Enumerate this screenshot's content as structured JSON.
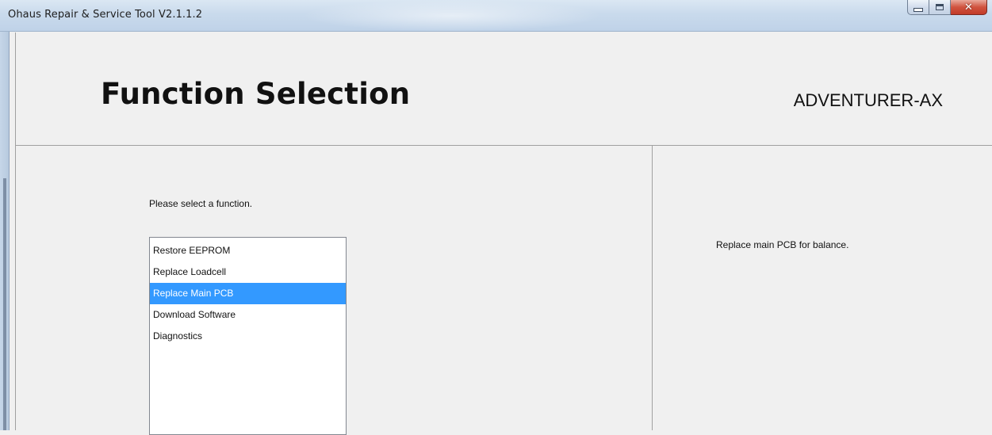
{
  "window": {
    "title": "Ohaus Repair & Service Tool  V2.1.1.2",
    "controls": {
      "minimize_icon": "minimize-icon",
      "maximize_icon": "maximize-icon",
      "close_icon": "close-icon",
      "close_glyph": "✕"
    }
  },
  "header": {
    "title": "Function Selection",
    "model": "ADVENTURER-AX"
  },
  "functions": {
    "prompt": "Please select a function.",
    "items": [
      {
        "label": "Restore EEPROM",
        "selected": false
      },
      {
        "label": "Replace Loadcell",
        "selected": false
      },
      {
        "label": "Replace Main PCB",
        "selected": true
      },
      {
        "label": "Download Software",
        "selected": false
      },
      {
        "label": "Diagnostics",
        "selected": false
      }
    ],
    "selection_color": "#3399ff"
  },
  "description": {
    "text": "Replace main PCB for balance."
  }
}
